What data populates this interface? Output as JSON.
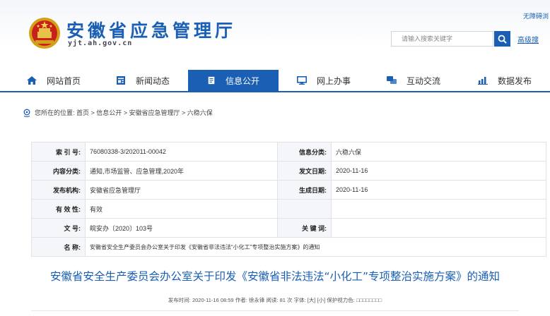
{
  "header": {
    "site_title": "安徽省应急管理厅",
    "site_domain": "yjt.ah.gov.cn",
    "top_link": "无障碍浏",
    "search_placeholder": "请输入搜索关键字",
    "advanced_search": "高级搜"
  },
  "nav": {
    "items": [
      {
        "label": "网站首页",
        "icon": "home-icon"
      },
      {
        "label": "新闻动态",
        "icon": "news-icon"
      },
      {
        "label": "信息公开",
        "icon": "document-icon"
      },
      {
        "label": "网上办事",
        "icon": "monitor-icon"
      },
      {
        "label": "互动交流",
        "icon": "chat-icon"
      },
      {
        "label": "数据发布",
        "icon": "chart-icon"
      }
    ],
    "active_index": 2
  },
  "breadcrumb": {
    "text": "您所在的位置: 首页 > 信息公开 > 安徽省应急管理厅 > 六稳六保"
  },
  "info_table": {
    "rows": [
      {
        "k1": "索 引 号:",
        "v1": "76080338-3/202011-00042",
        "k2": "信息分类:",
        "v2": "六稳六保"
      },
      {
        "k1": "内容分类:",
        "v1": "通知,市场监管、应急管理,2020年",
        "k2": "发文日期:",
        "v2": "2020-11-16"
      },
      {
        "k1": "发布机构:",
        "v1": "安徽省应急管理厅",
        "k2": "生成日期:",
        "v2": "2020-11-16"
      },
      {
        "k1": "有 效 性:",
        "v1": "有效",
        "k2": "",
        "v2": ""
      },
      {
        "k1": "文     号:",
        "v1": "皖安办〔2020〕103号",
        "k2": "关 键 词:",
        "v2": ""
      }
    ],
    "name_key": "名     称:",
    "name_value": "安徽省安全生产委员会办公室关于印发《安徽省非法违法“小化工”专项整治实施方案》的通知"
  },
  "document": {
    "title": "安徽省安全生产委员会办公室关于印发《安徽省非法违法“小化工”专项整治实施方案》的通知",
    "meta": "发布时间: 2020-11-16 08:59   作者: 徐永锋   阅读: 81 次   字体: [大] [小]   保护视力色: □□□□□□□□"
  },
  "colors": {
    "brand_blue": "#1a5fb4",
    "table_key_bg": "#f4f6f9",
    "border": "#dfe3e8"
  }
}
